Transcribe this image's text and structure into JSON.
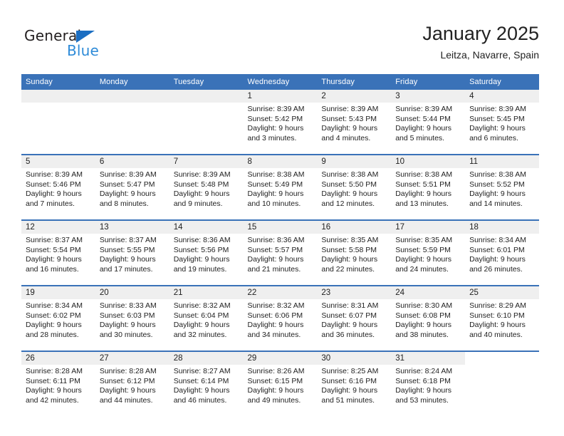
{
  "brand": {
    "name_top": "General",
    "name_bottom": "Blue",
    "accent_color": "#1b6ec2",
    "accent_color_light": "#2e8bd8"
  },
  "header": {
    "title": "January 2025",
    "subtitle": "Leitza, Navarre, Spain"
  },
  "theme": {
    "header_row_bg": "#3a72b8",
    "daynum_strip_bg": "#efefef",
    "row_divider": "#3a72b8",
    "text": "#1f1f1f"
  },
  "weekday_headers": [
    "Sunday",
    "Monday",
    "Tuesday",
    "Wednesday",
    "Thursday",
    "Friday",
    "Saturday"
  ],
  "weeks": [
    [
      {
        "day": "",
        "empty": true,
        "sunrise": "",
        "sunset": "",
        "daylight_line1": "",
        "daylight_line2": ""
      },
      {
        "day": "",
        "empty": true,
        "sunrise": "",
        "sunset": "",
        "daylight_line1": "",
        "daylight_line2": ""
      },
      {
        "day": "",
        "empty": true,
        "sunrise": "",
        "sunset": "",
        "daylight_line1": "",
        "daylight_line2": ""
      },
      {
        "day": "1",
        "sunrise": "Sunrise: 8:39 AM",
        "sunset": "Sunset: 5:42 PM",
        "daylight_line1": "Daylight: 9 hours",
        "daylight_line2": "and 3 minutes."
      },
      {
        "day": "2",
        "sunrise": "Sunrise: 8:39 AM",
        "sunset": "Sunset: 5:43 PM",
        "daylight_line1": "Daylight: 9 hours",
        "daylight_line2": "and 4 minutes."
      },
      {
        "day": "3",
        "sunrise": "Sunrise: 8:39 AM",
        "sunset": "Sunset: 5:44 PM",
        "daylight_line1": "Daylight: 9 hours",
        "daylight_line2": "and 5 minutes."
      },
      {
        "day": "4",
        "sunrise": "Sunrise: 8:39 AM",
        "sunset": "Sunset: 5:45 PM",
        "daylight_line1": "Daylight: 9 hours",
        "daylight_line2": "and 6 minutes."
      }
    ],
    [
      {
        "day": "5",
        "sunrise": "Sunrise: 8:39 AM",
        "sunset": "Sunset: 5:46 PM",
        "daylight_line1": "Daylight: 9 hours",
        "daylight_line2": "and 7 minutes."
      },
      {
        "day": "6",
        "sunrise": "Sunrise: 8:39 AM",
        "sunset": "Sunset: 5:47 PM",
        "daylight_line1": "Daylight: 9 hours",
        "daylight_line2": "and 8 minutes."
      },
      {
        "day": "7",
        "sunrise": "Sunrise: 8:39 AM",
        "sunset": "Sunset: 5:48 PM",
        "daylight_line1": "Daylight: 9 hours",
        "daylight_line2": "and 9 minutes."
      },
      {
        "day": "8",
        "sunrise": "Sunrise: 8:38 AM",
        "sunset": "Sunset: 5:49 PM",
        "daylight_line1": "Daylight: 9 hours",
        "daylight_line2": "and 10 minutes."
      },
      {
        "day": "9",
        "sunrise": "Sunrise: 8:38 AM",
        "sunset": "Sunset: 5:50 PM",
        "daylight_line1": "Daylight: 9 hours",
        "daylight_line2": "and 12 minutes."
      },
      {
        "day": "10",
        "sunrise": "Sunrise: 8:38 AM",
        "sunset": "Sunset: 5:51 PM",
        "daylight_line1": "Daylight: 9 hours",
        "daylight_line2": "and 13 minutes."
      },
      {
        "day": "11",
        "sunrise": "Sunrise: 8:38 AM",
        "sunset": "Sunset: 5:52 PM",
        "daylight_line1": "Daylight: 9 hours",
        "daylight_line2": "and 14 minutes."
      }
    ],
    [
      {
        "day": "12",
        "sunrise": "Sunrise: 8:37 AM",
        "sunset": "Sunset: 5:54 PM",
        "daylight_line1": "Daylight: 9 hours",
        "daylight_line2": "and 16 minutes."
      },
      {
        "day": "13",
        "sunrise": "Sunrise: 8:37 AM",
        "sunset": "Sunset: 5:55 PM",
        "daylight_line1": "Daylight: 9 hours",
        "daylight_line2": "and 17 minutes."
      },
      {
        "day": "14",
        "sunrise": "Sunrise: 8:36 AM",
        "sunset": "Sunset: 5:56 PM",
        "daylight_line1": "Daylight: 9 hours",
        "daylight_line2": "and 19 minutes."
      },
      {
        "day": "15",
        "sunrise": "Sunrise: 8:36 AM",
        "sunset": "Sunset: 5:57 PM",
        "daylight_line1": "Daylight: 9 hours",
        "daylight_line2": "and 21 minutes."
      },
      {
        "day": "16",
        "sunrise": "Sunrise: 8:35 AM",
        "sunset": "Sunset: 5:58 PM",
        "daylight_line1": "Daylight: 9 hours",
        "daylight_line2": "and 22 minutes."
      },
      {
        "day": "17",
        "sunrise": "Sunrise: 8:35 AM",
        "sunset": "Sunset: 5:59 PM",
        "daylight_line1": "Daylight: 9 hours",
        "daylight_line2": "and 24 minutes."
      },
      {
        "day": "18",
        "sunrise": "Sunrise: 8:34 AM",
        "sunset": "Sunset: 6:01 PM",
        "daylight_line1": "Daylight: 9 hours",
        "daylight_line2": "and 26 minutes."
      }
    ],
    [
      {
        "day": "19",
        "sunrise": "Sunrise: 8:34 AM",
        "sunset": "Sunset: 6:02 PM",
        "daylight_line1": "Daylight: 9 hours",
        "daylight_line2": "and 28 minutes."
      },
      {
        "day": "20",
        "sunrise": "Sunrise: 8:33 AM",
        "sunset": "Sunset: 6:03 PM",
        "daylight_line1": "Daylight: 9 hours",
        "daylight_line2": "and 30 minutes."
      },
      {
        "day": "21",
        "sunrise": "Sunrise: 8:32 AM",
        "sunset": "Sunset: 6:04 PM",
        "daylight_line1": "Daylight: 9 hours",
        "daylight_line2": "and 32 minutes."
      },
      {
        "day": "22",
        "sunrise": "Sunrise: 8:32 AM",
        "sunset": "Sunset: 6:06 PM",
        "daylight_line1": "Daylight: 9 hours",
        "daylight_line2": "and 34 minutes."
      },
      {
        "day": "23",
        "sunrise": "Sunrise: 8:31 AM",
        "sunset": "Sunset: 6:07 PM",
        "daylight_line1": "Daylight: 9 hours",
        "daylight_line2": "and 36 minutes."
      },
      {
        "day": "24",
        "sunrise": "Sunrise: 8:30 AM",
        "sunset": "Sunset: 6:08 PM",
        "daylight_line1": "Daylight: 9 hours",
        "daylight_line2": "and 38 minutes."
      },
      {
        "day": "25",
        "sunrise": "Sunrise: 8:29 AM",
        "sunset": "Sunset: 6:10 PM",
        "daylight_line1": "Daylight: 9 hours",
        "daylight_line2": "and 40 minutes."
      }
    ],
    [
      {
        "day": "26",
        "sunrise": "Sunrise: 8:28 AM",
        "sunset": "Sunset: 6:11 PM",
        "daylight_line1": "Daylight: 9 hours",
        "daylight_line2": "and 42 minutes."
      },
      {
        "day": "27",
        "sunrise": "Sunrise: 8:28 AM",
        "sunset": "Sunset: 6:12 PM",
        "daylight_line1": "Daylight: 9 hours",
        "daylight_line2": "and 44 minutes."
      },
      {
        "day": "28",
        "sunrise": "Sunrise: 8:27 AM",
        "sunset": "Sunset: 6:14 PM",
        "daylight_line1": "Daylight: 9 hours",
        "daylight_line2": "and 46 minutes."
      },
      {
        "day": "29",
        "sunrise": "Sunrise: 8:26 AM",
        "sunset": "Sunset: 6:15 PM",
        "daylight_line1": "Daylight: 9 hours",
        "daylight_line2": "and 49 minutes."
      },
      {
        "day": "30",
        "sunrise": "Sunrise: 8:25 AM",
        "sunset": "Sunset: 6:16 PM",
        "daylight_line1": "Daylight: 9 hours",
        "daylight_line2": "and 51 minutes."
      },
      {
        "day": "31",
        "sunrise": "Sunrise: 8:24 AM",
        "sunset": "Sunset: 6:18 PM",
        "daylight_line1": "Daylight: 9 hours",
        "daylight_line2": "and 53 minutes."
      },
      {
        "day": "",
        "empty": true,
        "trailing": true,
        "sunrise": "",
        "sunset": "",
        "daylight_line1": "",
        "daylight_line2": ""
      }
    ]
  ]
}
